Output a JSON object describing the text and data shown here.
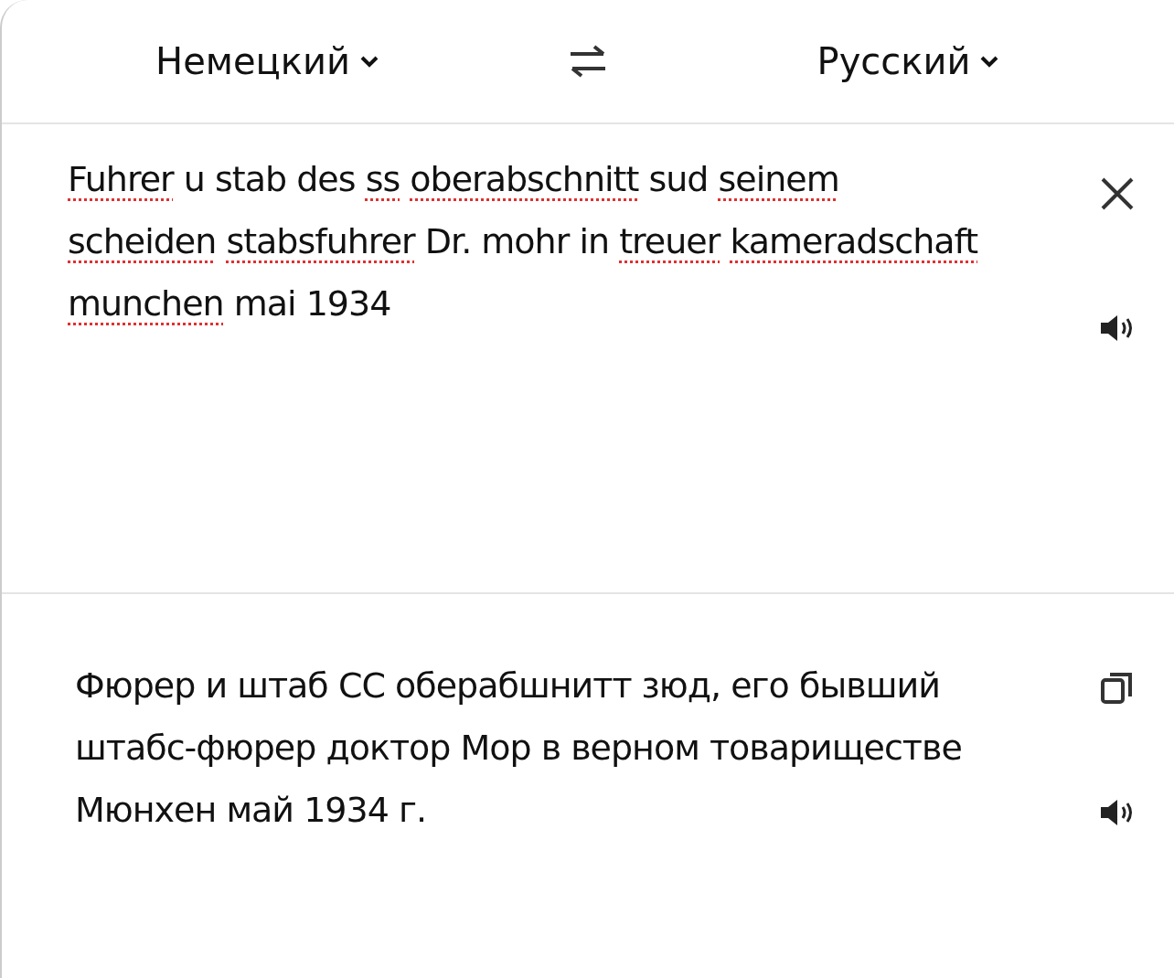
{
  "language_bar": {
    "source_language": "Немецкий",
    "target_language": "Русский"
  },
  "source": {
    "words": [
      {
        "text": "Fuhrer",
        "flagged": true
      },
      {
        "text": "u",
        "flagged": false
      },
      {
        "text": "stab",
        "flagged": false
      },
      {
        "text": "des",
        "flagged": false
      },
      {
        "text": "ss",
        "flagged": true
      },
      {
        "text": "oberabschnitt",
        "flagged": true
      },
      {
        "text": "sud",
        "flagged": false
      },
      {
        "text": "seinem",
        "flagged": true
      },
      {
        "text": "scheiden",
        "flagged": true
      },
      {
        "text": " stabsfuhrer",
        "flagged": true
      },
      {
        "text": "Dr.",
        "flagged": false
      },
      {
        "text": "mohr",
        "flagged": false
      },
      {
        "text": "in",
        "flagged": false
      },
      {
        "text": "treuer",
        "flagged": true
      },
      {
        "text": "kameradschaft",
        "flagged": true
      },
      {
        "text": " munchen",
        "flagged": true
      },
      {
        "text": "mai",
        "flagged": false
      },
      {
        "text": "1934",
        "flagged": false
      }
    ]
  },
  "translation": {
    "text": "Фюрер и штаб СС оберабшнитт зюд, его бывший штабс-фюрер доктор Мор в верном товариществе Мюнхен май 1934 г."
  }
}
